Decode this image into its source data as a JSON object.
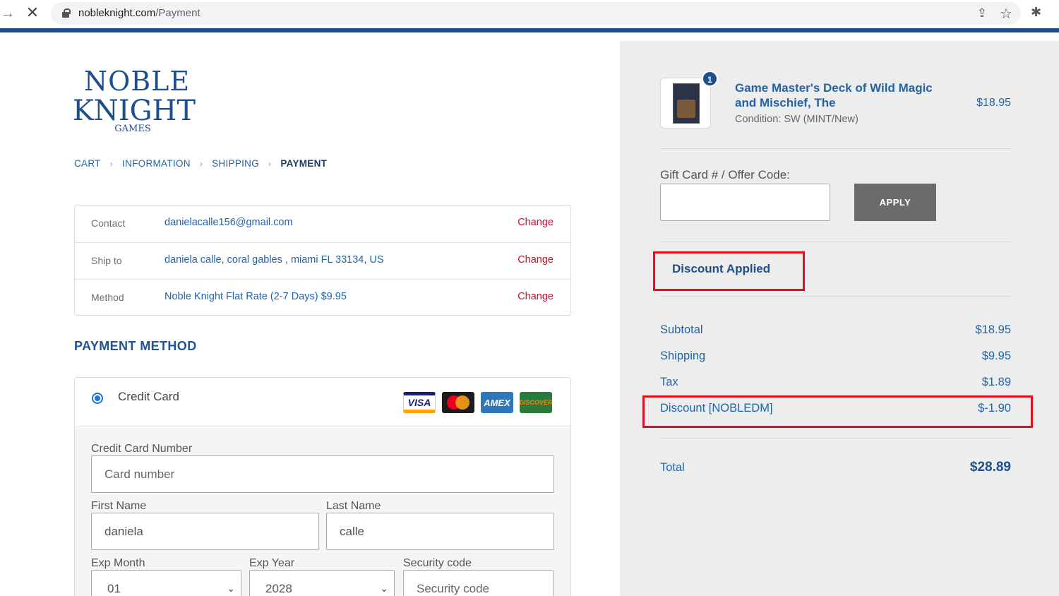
{
  "browser": {
    "url_host": "nobleknight.com",
    "url_path": "/Payment"
  },
  "logo": {
    "line1": "NOBLE",
    "line2": "KNIGHT",
    "line3": "GAMES"
  },
  "breadcrumb": [
    {
      "label": "CART"
    },
    {
      "label": "INFORMATION"
    },
    {
      "label": "SHIPPING"
    },
    {
      "label": "PAYMENT"
    }
  ],
  "review": {
    "rows": [
      {
        "label": "Contact",
        "value": "danielacalle156@gmail.com",
        "action": "Change"
      },
      {
        "label": "Ship to",
        "value": "daniela calle, coral gables , miami FL 33134, US",
        "action": "Change"
      },
      {
        "label": "Method",
        "value": "Noble Knight Flat Rate (2-7 Days) $9.95",
        "action": "Change"
      }
    ]
  },
  "payment": {
    "title": "PAYMENT METHOD",
    "option_label": "Credit Card",
    "cards": {
      "visa": "VISA",
      "mastercard": "MasterCard",
      "amex": "AMEX",
      "discover": "DISCOVER"
    },
    "card_number": {
      "label": "Credit Card Number",
      "placeholder": "Card number"
    },
    "first_name": {
      "label": "First Name",
      "value": "daniela"
    },
    "last_name": {
      "label": "Last Name",
      "value": "calle"
    },
    "exp_month": {
      "label": "Exp Month",
      "value": "01"
    },
    "exp_year": {
      "label": "Exp Year",
      "value": "2028"
    },
    "security": {
      "label": "Security code",
      "placeholder": "Security code"
    }
  },
  "order": {
    "quantity": "1",
    "product_title": "Game Master's Deck of Wild Magic and Mischief, The",
    "condition": "Condition: SW (MINT/New)",
    "price": "$18.95"
  },
  "gift": {
    "label": "Gift Card # / Offer Code:",
    "apply_label": "APPLY",
    "discount_applied": "Discount Applied"
  },
  "summary": {
    "subtotal": {
      "label": "Subtotal",
      "value": "$18.95"
    },
    "shipping": {
      "label": "Shipping",
      "value": "$9.95"
    },
    "tax": {
      "label": "Tax",
      "value": "$1.89"
    },
    "discount": {
      "label": "Discount [NOBLEDM]",
      "value": "$-1.90"
    },
    "total": {
      "label": "Total",
      "value": "$28.89"
    }
  },
  "colors": {
    "brand_blue": "#1f4e8c",
    "link_blue": "#2264a8",
    "change_red": "#c8102e",
    "highlight_red": "#e01020",
    "sidebar_bg": "#ededed"
  }
}
